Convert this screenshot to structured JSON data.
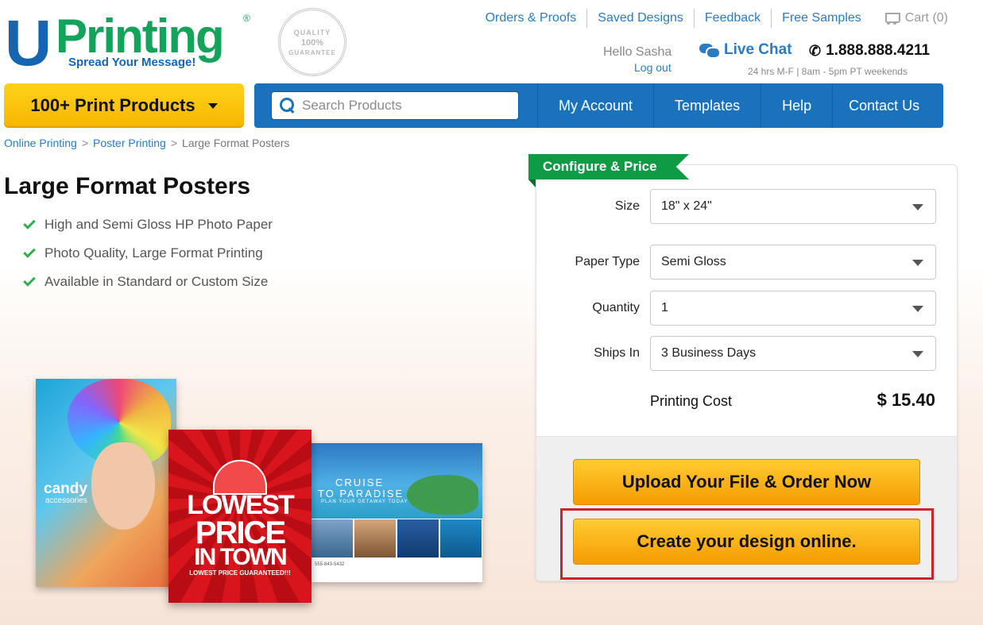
{
  "logo": {
    "u": "U",
    "printing": "Printing",
    "reg": "®",
    "tagline": "Spread Your Message!"
  },
  "seal": {
    "top": "QUALITY",
    "middle": "100%",
    "bottom": "GUARANTEE"
  },
  "top_links": [
    "Orders & Proofs",
    "Saved Designs",
    "Feedback",
    "Free Samples"
  ],
  "cart": {
    "label": "Cart (0)",
    "icon": "cart-icon"
  },
  "user": {
    "greeting": "Hello Sasha",
    "logout": "Log out"
  },
  "live_chat": {
    "label": "Live Chat",
    "icon": "chat-bubble-icon"
  },
  "phone": {
    "number": "1.888.888.4211",
    "hours": "24 hrs M-F | 8am - 5pm PT weekends",
    "icon": "phone-icon"
  },
  "products_button": "100+ Print Products",
  "search": {
    "placeholder": "Search Products",
    "icon": "search-icon"
  },
  "nav": [
    "My Account",
    "Templates",
    "Help",
    "Contact Us"
  ],
  "breadcrumb": [
    "Online Printing",
    "Poster Printing",
    "Large Format Posters"
  ],
  "page_title": "Large Format Posters",
  "features": [
    "High and Semi Gloss HP Photo Paper",
    "Photo Quality, Large Format Printing",
    "Available in Standard or Custom Size"
  ],
  "posters": {
    "candy": {
      "title": "candy",
      "subtitle": "accessories"
    },
    "price": {
      "line1": "LOWEST",
      "line2": "PRICE",
      "line3": "IN TOWN",
      "line4": "LOWEST PRICE GUARANTEED!!!"
    },
    "cruise": {
      "line1": "CRUISE",
      "line2": "TO PARADISE",
      "line3": "PLAN YOUR GETAWAY TODAY",
      "footer": "555-843-5432"
    }
  },
  "configure": {
    "ribbon": "Configure & Price",
    "options": [
      {
        "label": "Size",
        "value": "18\" x 24\""
      },
      {
        "label": "Paper Type",
        "value": "Semi Gloss"
      },
      {
        "label": "Quantity",
        "value": "1"
      },
      {
        "label": "Ships In",
        "value": "3 Business Days"
      }
    ],
    "cost_label": "Printing Cost",
    "cost_value": "$ 15.40",
    "upload_button": "Upload Your File & Order Now",
    "design_button": "Create your design online."
  },
  "colors": {
    "brand_blue": "#1a72bc",
    "brand_green": "#14a35a",
    "cta_orange": "#f5a200",
    "highlight_red": "#d0222a"
  }
}
